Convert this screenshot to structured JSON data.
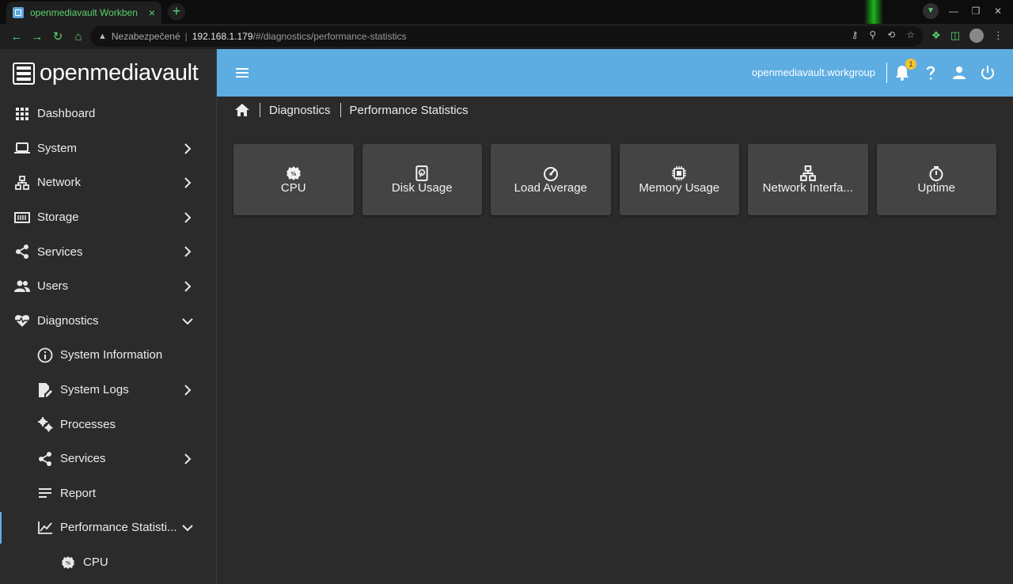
{
  "browser": {
    "tab_title": "openmediavault Workben",
    "tab_close": "×",
    "new_tab": "+",
    "security_label": "Nezabezpečené",
    "url_host": "192.168.1.179",
    "url_path": "/#/diagnostics/performance-statistics"
  },
  "brand": {
    "name": "openmediavault"
  },
  "header": {
    "hostname": "openmediavault.workgroup",
    "notification_count": "1"
  },
  "sidebar": {
    "items": [
      {
        "label": "Dashboard",
        "icon": "dashboard-icon"
      },
      {
        "label": "System",
        "icon": "laptop-icon"
      },
      {
        "label": "Network",
        "icon": "network-icon"
      },
      {
        "label": "Storage",
        "icon": "storage-icon"
      },
      {
        "label": "Services",
        "icon": "share-icon"
      },
      {
        "label": "Users",
        "icon": "users-icon"
      },
      {
        "label": "Diagnostics",
        "icon": "heart-pulse-icon"
      },
      {
        "label": "System Information",
        "icon": "info-icon"
      },
      {
        "label": "System Logs",
        "icon": "file-edit-icon"
      },
      {
        "label": "Processes",
        "icon": "cogs-icon"
      },
      {
        "label": "Services",
        "icon": "share-icon"
      },
      {
        "label": "Report",
        "icon": "text-lines-icon"
      },
      {
        "label": "Performance Statisti...",
        "icon": "chart-line-icon"
      },
      {
        "label": "CPU",
        "icon": "cpu-icon"
      }
    ]
  },
  "breadcrumb": {
    "items": [
      "Diagnostics",
      "Performance Statistics"
    ]
  },
  "cards": [
    {
      "label": "CPU",
      "icon": "cpu-icon"
    },
    {
      "label": "Disk Usage",
      "icon": "disk-icon"
    },
    {
      "label": "Load Average",
      "icon": "gauge-icon"
    },
    {
      "label": "Memory Usage",
      "icon": "memory-chip-icon"
    },
    {
      "label": "Network Interfa...",
      "icon": "network-icon"
    },
    {
      "label": "Uptime",
      "icon": "stopwatch-icon"
    }
  ]
}
